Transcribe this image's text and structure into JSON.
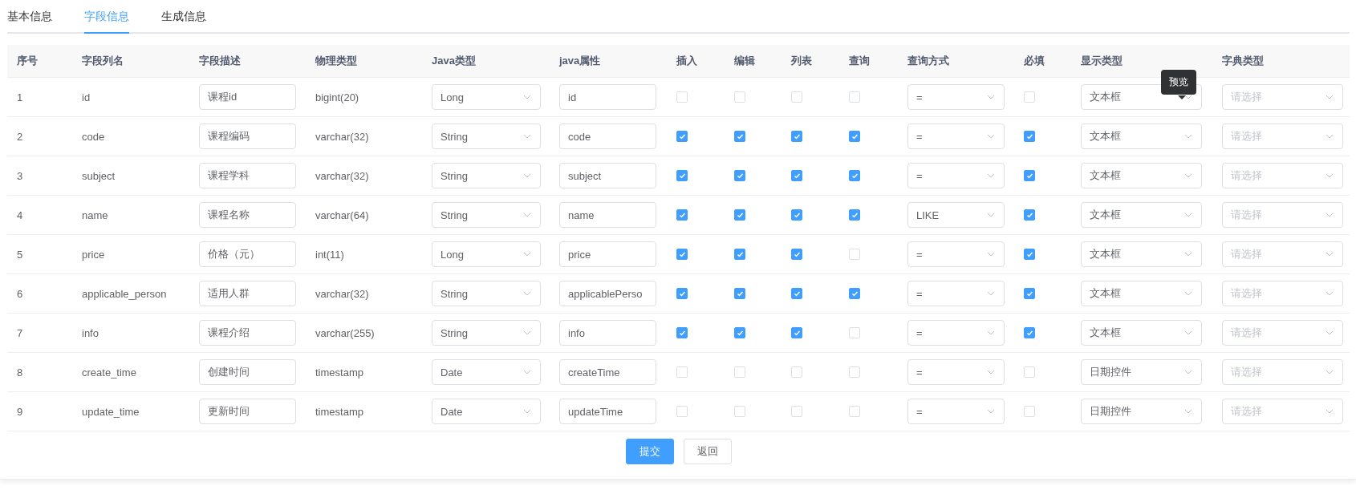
{
  "tabs": [
    {
      "label": "基本信息",
      "selected": false
    },
    {
      "label": "字段信息",
      "selected": true
    },
    {
      "label": "生成信息",
      "selected": false
    }
  ],
  "table": {
    "columns": [
      "序号",
      "字段列名",
      "字段描述",
      "物理类型",
      "Java类型",
      "java属性",
      "插入",
      "编辑",
      "列表",
      "查询",
      "查询方式",
      "必填",
      "显示类型",
      "字典类型"
    ],
    "rows": [
      {
        "index": "1",
        "column_name": "id",
        "description": "课程id",
        "physical_type": "bigint(20)",
        "java_type": "Long",
        "java_field": "id",
        "insert": false,
        "edit": false,
        "list": false,
        "query": false,
        "query_type": "=",
        "required": false,
        "display_type": "文本框",
        "display_tooltip": "预览",
        "dict_type": {
          "placeholder": "请选择"
        }
      },
      {
        "index": "2",
        "column_name": "code",
        "description": "课程编码",
        "physical_type": "varchar(32)",
        "java_type": "String",
        "java_field": "code",
        "insert": true,
        "edit": true,
        "list": true,
        "query": true,
        "query_type": "=",
        "required": true,
        "display_type": "文本框",
        "dict_type": {
          "placeholder": "请选择"
        }
      },
      {
        "index": "3",
        "column_name": "subject",
        "description": "课程学科",
        "physical_type": "varchar(32)",
        "java_type": "String",
        "java_field": "subject",
        "insert": true,
        "edit": true,
        "list": true,
        "query": true,
        "query_type": "=",
        "required": true,
        "display_type": "文本框",
        "dict_type": {
          "placeholder": "请选择"
        }
      },
      {
        "index": "4",
        "column_name": "name",
        "description": "课程名称",
        "physical_type": "varchar(64)",
        "java_type": "String",
        "java_field": "name",
        "insert": true,
        "edit": true,
        "list": true,
        "query": true,
        "query_type": "LIKE",
        "required": true,
        "display_type": "文本框",
        "dict_type": {
          "placeholder": "请选择"
        }
      },
      {
        "index": "5",
        "column_name": "price",
        "description": "价格（元）",
        "physical_type": "int(11)",
        "java_type": "Long",
        "java_field": "price",
        "insert": true,
        "edit": true,
        "list": true,
        "query": false,
        "query_type": "=",
        "required": true,
        "display_type": "文本框",
        "dict_type": {
          "placeholder": "请选择"
        }
      },
      {
        "index": "6",
        "column_name": "applicable_person",
        "description": "适用人群",
        "physical_type": "varchar(32)",
        "java_type": "String",
        "java_field": "applicablePerso",
        "insert": true,
        "edit": true,
        "list": true,
        "query": true,
        "query_type": "=",
        "required": true,
        "display_type": "文本框",
        "dict_type": {
          "placeholder": "请选择"
        }
      },
      {
        "index": "7",
        "column_name": "info",
        "description": "课程介绍",
        "physical_type": "varchar(255)",
        "java_type": "String",
        "java_field": "info",
        "insert": true,
        "edit": true,
        "list": true,
        "query": false,
        "query_type": "=",
        "required": true,
        "display_type": "文本框",
        "dict_type": {
          "placeholder": "请选择"
        }
      },
      {
        "index": "8",
        "column_name": "create_time",
        "description": "创建时间",
        "physical_type": "timestamp",
        "java_type": "Date",
        "java_field": "createTime",
        "insert": false,
        "edit": false,
        "list": false,
        "query": false,
        "query_type": "=",
        "required": false,
        "display_type": "日期控件",
        "dict_type": {
          "placeholder": "请选择"
        }
      },
      {
        "index": "9",
        "column_name": "update_time",
        "description": "更新时间",
        "physical_type": "timestamp",
        "java_type": "Date",
        "java_field": "updateTime",
        "insert": false,
        "edit": false,
        "list": false,
        "query": false,
        "query_type": "=",
        "required": false,
        "display_type": "日期控件",
        "dict_type": {
          "placeholder": "请选择"
        }
      }
    ]
  },
  "buttons": [
    {
      "label": "提交",
      "kind": "primary"
    },
    {
      "label": "返回",
      "kind": "default"
    }
  ]
}
